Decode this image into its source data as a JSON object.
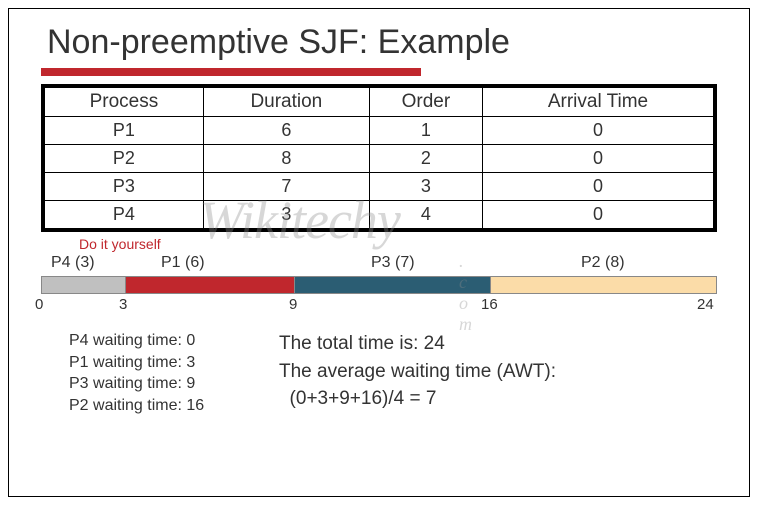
{
  "title": "Non-preemptive SJF: Example",
  "table": {
    "headers": [
      "Process",
      "Duration",
      "Order",
      "Arrival Time"
    ],
    "rows": [
      [
        "P1",
        "6",
        "1",
        "0"
      ],
      [
        "P2",
        "8",
        "2",
        "0"
      ],
      [
        "P3",
        "7",
        "3",
        "0"
      ],
      [
        "P4",
        "3",
        "4",
        "0"
      ]
    ]
  },
  "diy": "Do it yourself",
  "gantt": {
    "segments": [
      {
        "label": "P4 (3)",
        "width_pct": 12.5,
        "class": "p4"
      },
      {
        "label": "P1 (6)",
        "width_pct": 25.0,
        "class": "p1"
      },
      {
        "label": "P3 (7)",
        "width_pct": 29.17,
        "class": "p3"
      },
      {
        "label": "P2 (8)",
        "width_pct": 33.33,
        "class": "p2"
      }
    ],
    "ticks": [
      "0",
      "3",
      "9",
      "16",
      "24"
    ]
  },
  "waits": [
    "P4 waiting time: 0",
    "P1 waiting time: 3",
    "P3 waiting time: 9",
    "P2 waiting time: 16"
  ],
  "summary": {
    "total": "The total time is: 24",
    "awt_label": "The average waiting time (AWT):",
    "awt_calc": "  (0+3+9+16)/4 = 7"
  },
  "watermark": "Wikitechy",
  "watermark_sub": ". c o m"
}
